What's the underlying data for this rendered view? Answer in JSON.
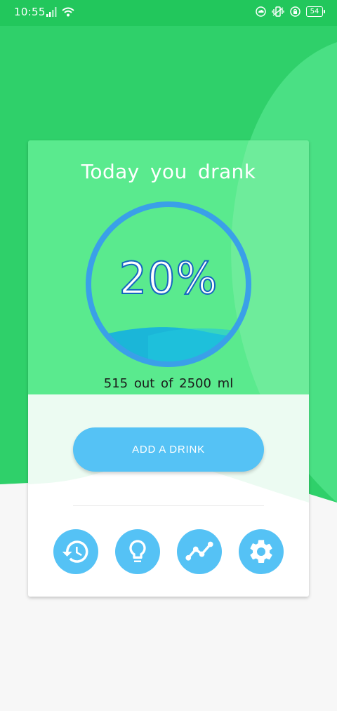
{
  "status_bar": {
    "time": "10:55",
    "battery": "54"
  },
  "card": {
    "title": "Today you drank",
    "percent": "20%",
    "progress": 0.2,
    "amount_text": "515 out of 2500 ml",
    "add_button_label": "ADD A DRINK"
  },
  "bottom_actions": [
    {
      "name": "history-button",
      "icon": "history-icon"
    },
    {
      "name": "tips-button",
      "icon": "lightbulb-icon"
    },
    {
      "name": "stats-button",
      "icon": "trend-chart-icon"
    },
    {
      "name": "settings-button",
      "icon": "gear-icon"
    }
  ],
  "colors": {
    "status_bar": "#22c75c",
    "background_green": "#2fd06a",
    "card_top": "#5aea8e",
    "accent_blue": "#55c2f5",
    "ring_blue": "#3aa0e8",
    "water": "#1bb6d8"
  }
}
